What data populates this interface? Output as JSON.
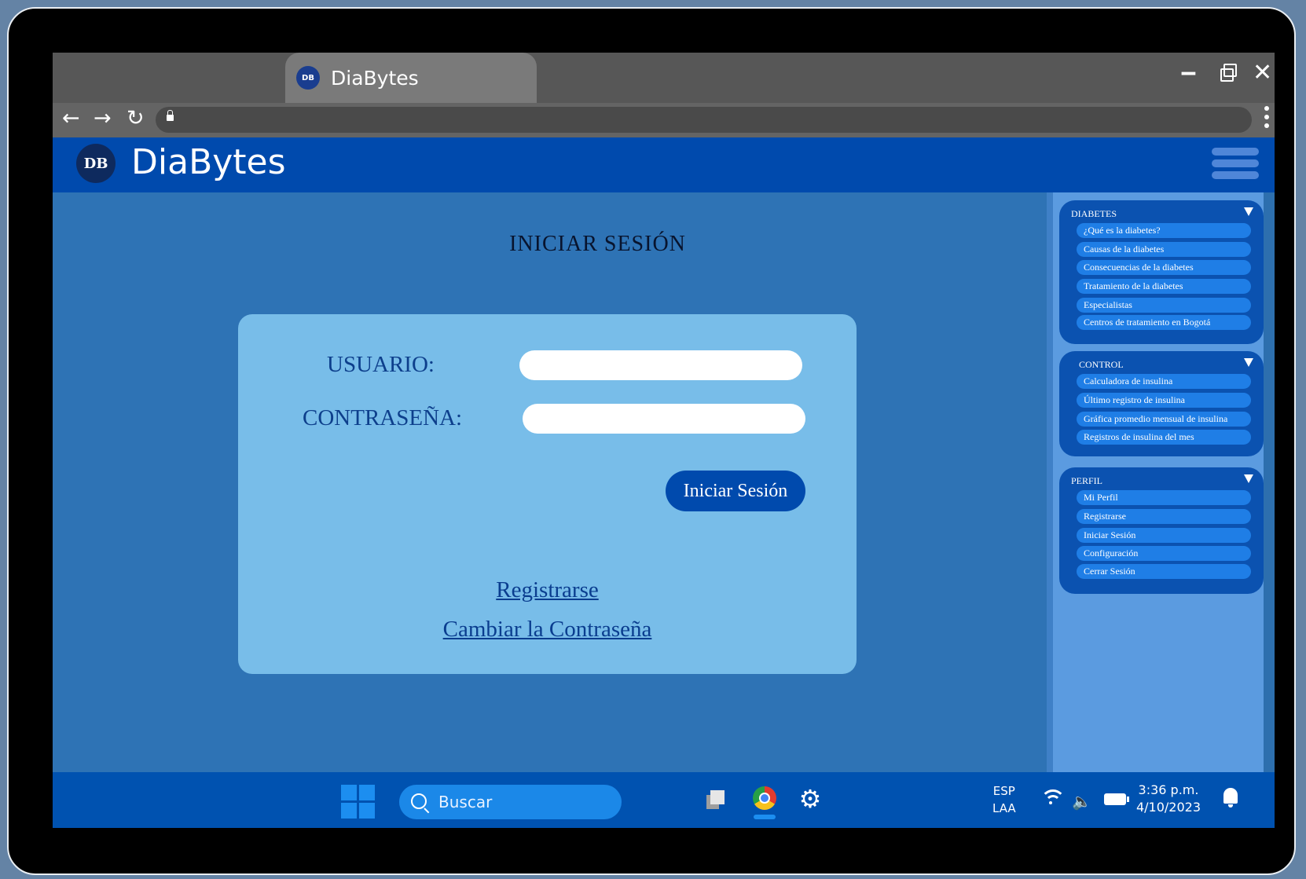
{
  "browser": {
    "tab_title": "DiaBytes",
    "favicon_text": "DB"
  },
  "app": {
    "title": "DiaBytes",
    "logo_text": "DB"
  },
  "login": {
    "heading": "INICIAR SESIÓN",
    "user_label": "USUARIO:",
    "user_value": "",
    "password_label": "CONTRASEÑA:",
    "password_value": "",
    "submit_label": "Iniciar Sesión",
    "register_link": "Registrarse ",
    "change_password_link": "Cambiar la Contraseña"
  },
  "sidebar": {
    "groups": [
      {
        "title": "DIABETES",
        "items": [
          "¿Qué es la diabetes?",
          "Causas de la diabetes",
          "Consecuencias de la diabetes",
          "Tratamiento de la diabetes",
          "Especialistas",
          "Centros de tratamiento en Bogotá"
        ]
      },
      {
        "title": "CONTROL",
        "items": [
          "Calculadora de insulina",
          "Último registro de insulina",
          "Gráfica promedio mensual de insulina",
          "Registros de insulina del mes"
        ]
      },
      {
        "title": "PERFIL",
        "items": [
          "Mi Perfil",
          "Registrarse",
          "Iniciar Sesión",
          "Configuración",
          "Cerrar Sesión"
        ]
      }
    ]
  },
  "taskbar": {
    "search_placeholder": "Buscar",
    "lang_line1": "ESP",
    "lang_line2": "LAA",
    "time": "3:36 p.m.",
    "date": "4/10/2023"
  },
  "colors": {
    "header": "#004aad",
    "card": "#78bde9",
    "sidebar_group": "#0b52b0",
    "sidebar_item": "#1f7ee6",
    "taskbar": "#0052b0"
  }
}
